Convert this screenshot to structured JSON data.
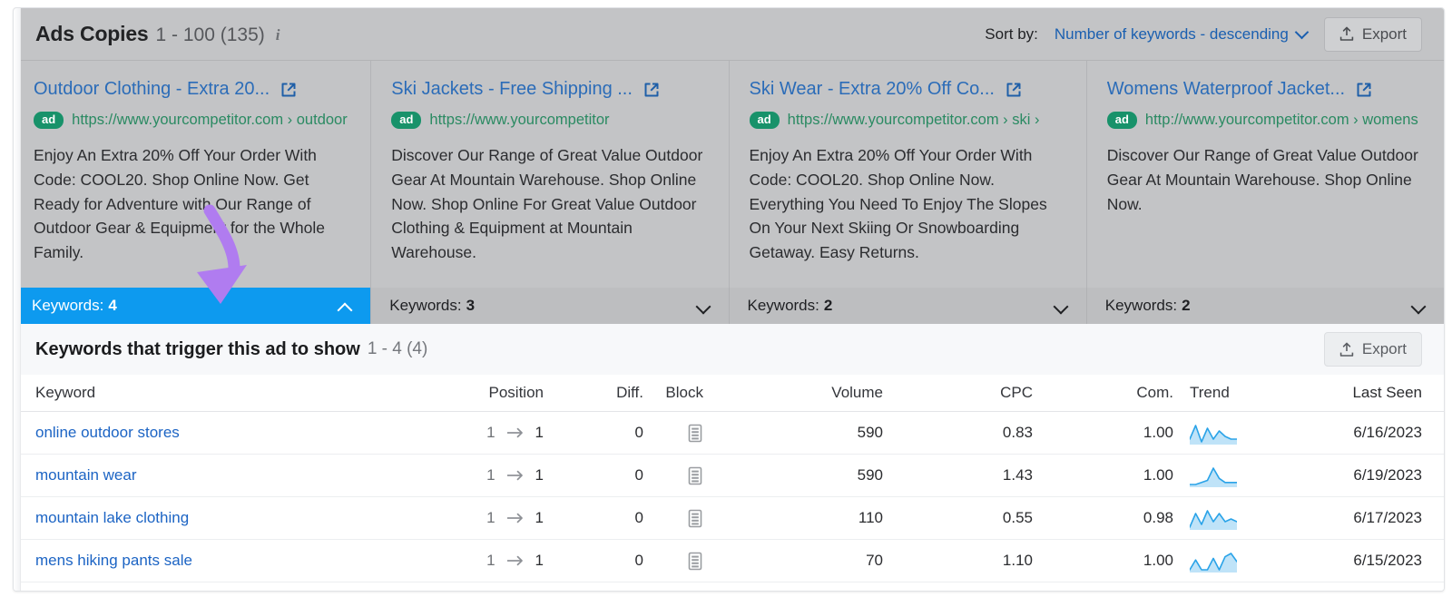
{
  "header": {
    "title": "Ads Copies",
    "range": "1 - 100 (135)",
    "info_icon": "info-icon",
    "sort_label": "Sort by:",
    "sort_value": "Number of keywords - descending",
    "export_label": "Export"
  },
  "ads": [
    {
      "title": "Outdoor Clothing - Extra 20...",
      "badge": "ad",
      "url": "https://www.yourcompetitor.com › outdoor › clothing",
      "description": "Enjoy An Extra 20% Off Your Order With Code: COOL20. Shop Online Now. Get Ready for Adventure with Our Range of Outdoor Gear & Equipment for the Whole Family.",
      "keywords_label": "Keywords:",
      "keywords_count": "4",
      "expanded": true
    },
    {
      "title": "Ski Jackets - Free Shipping ...",
      "badge": "ad",
      "url": "https://www.yourcompetitor",
      "description": "Discover Our Range of Great Value Outdoor Gear At Mountain Warehouse. Shop Online Now. Shop Online For Great Value Outdoor Clothing & Equipment at Mountain Warehouse.",
      "keywords_label": "Keywords:",
      "keywords_count": "3",
      "expanded": false
    },
    {
      "title": "Ski Wear - Extra 20% Off Co...",
      "badge": "ad",
      "url": "https://www.yourcompetitor.com › ski › wear",
      "description": "Enjoy An Extra 20% Off Your Order With Code: COOL20. Shop Online Now. Everything You Need To Enjoy The Slopes On Your Next Skiing Or Snowboarding Getaway. Easy Returns.",
      "keywords_label": "Keywords:",
      "keywords_count": "2",
      "expanded": false
    },
    {
      "title": "Womens Waterproof Jacket...",
      "badge": "ad",
      "url": "http://www.yourcompetitor.com › womens › rain-jackets",
      "description": "Discover Our Range of Great Value Outdoor Gear At Mountain Warehouse. Shop Online Now.",
      "keywords_label": "Keywords:",
      "keywords_count": "2",
      "expanded": false
    }
  ],
  "subsection": {
    "title": "Keywords that trigger this ad to show",
    "range": "1 - 4 (4)",
    "export_label": "Export"
  },
  "table": {
    "columns": [
      "Keyword",
      "Position",
      "Diff.",
      "Block",
      "Volume",
      "CPC",
      "Com.",
      "Trend",
      "Last Seen"
    ],
    "rows": [
      {
        "keyword": "online outdoor stores",
        "pos_from": "1",
        "pos_to": "1",
        "diff": "0",
        "block": "block-icon",
        "volume": "590",
        "cpc": "0.83",
        "com": "1.00",
        "trend": [
          4,
          9,
          3,
          8,
          4,
          7,
          5,
          4,
          4
        ],
        "last_seen": "6/16/2023"
      },
      {
        "keyword": "mountain wear",
        "pos_from": "1",
        "pos_to": "1",
        "diff": "0",
        "block": "block-icon",
        "volume": "590",
        "cpc": "1.43",
        "com": "1.00",
        "trend": [
          2,
          2,
          3,
          4,
          10,
          5,
          3,
          3,
          3
        ],
        "last_seen": "6/19/2023"
      },
      {
        "keyword": "mountain lake clothing",
        "pos_from": "1",
        "pos_to": "1",
        "diff": "0",
        "block": "block-icon",
        "volume": "110",
        "cpc": "0.55",
        "com": "0.98",
        "trend": [
          3,
          8,
          4,
          9,
          5,
          8,
          5,
          6,
          5
        ],
        "last_seen": "6/17/2023"
      },
      {
        "keyword": "mens hiking pants sale",
        "pos_from": "1",
        "pos_to": "1",
        "diff": "0",
        "block": "block-icon",
        "volume": "70",
        "cpc": "1.10",
        "com": "1.00",
        "trend": [
          1,
          7,
          1,
          1,
          8,
          1,
          9,
          11,
          6
        ],
        "last_seen": "6/15/2023"
      }
    ]
  },
  "annotation": {
    "type": "curved-arrow",
    "color": "#b07cf0"
  },
  "colors": {
    "accent_blue": "#0d9aef",
    "link_blue": "#1c64c4",
    "ad_green": "#18926a",
    "header_gray": "#c3c4c6",
    "annotation_purple": "#b07cf0"
  }
}
